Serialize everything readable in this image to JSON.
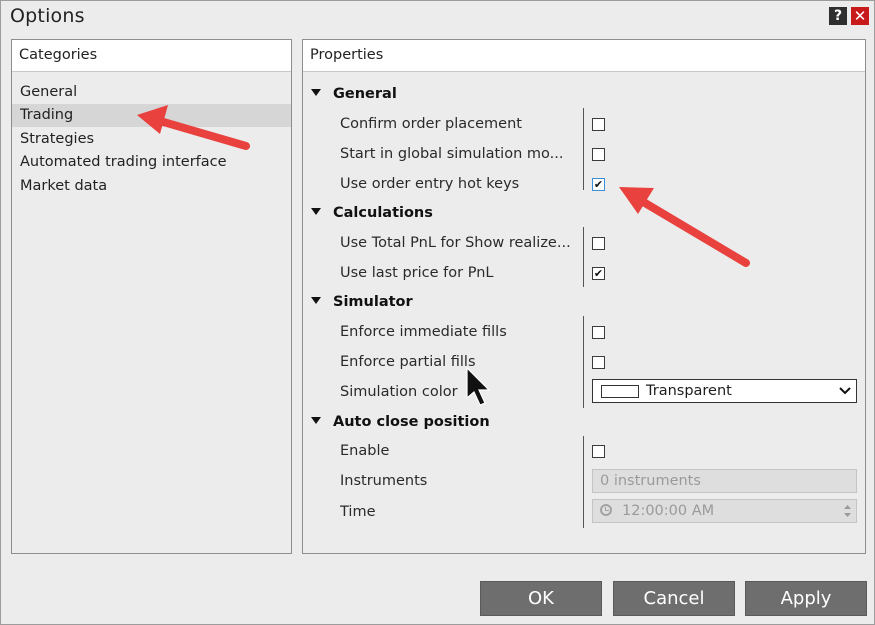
{
  "window": {
    "title": "Options",
    "help_label": "?",
    "close_label": "✕"
  },
  "categories": {
    "header": "Categories",
    "items": [
      {
        "label": "General"
      },
      {
        "label": "Trading"
      },
      {
        "label": "Strategies"
      },
      {
        "label": "Automated trading interface"
      },
      {
        "label": "Market data"
      }
    ],
    "selected": "Trading"
  },
  "properties": {
    "header": "Properties",
    "sections": [
      {
        "title": "General",
        "rows": [
          {
            "label": "Confirm order placement",
            "checked": false
          },
          {
            "label": "Start in global simulation mo...",
            "checked": false
          },
          {
            "label": "Use order entry hot keys",
            "checked": true
          }
        ]
      },
      {
        "title": "Calculations",
        "rows": [
          {
            "label": "Use Total PnL for Show realize...",
            "checked": false
          },
          {
            "label": "Use last price for PnL",
            "checked": true
          }
        ]
      },
      {
        "title": "Simulator",
        "rows": [
          {
            "label": "Enforce immediate fills",
            "checked": false
          },
          {
            "label": "Enforce partial fills",
            "checked": false
          },
          {
            "label": "Simulation color",
            "value": "Transparent"
          }
        ]
      },
      {
        "title": "Auto close position",
        "rows": [
          {
            "label": "Enable",
            "checked": false
          },
          {
            "label": "Instruments",
            "value": "0 instruments"
          },
          {
            "label": "Time",
            "value": "12:00:00 AM"
          }
        ]
      }
    ]
  },
  "checkmark": "✔",
  "buttons": {
    "ok": "OK",
    "cancel": "Cancel",
    "apply": "Apply"
  },
  "colors": {
    "annotation_arrow": "#e8413e",
    "close_button": "#c8191b",
    "button_bg": "#6e6e6e",
    "selected_row": "#d6d6d6"
  }
}
